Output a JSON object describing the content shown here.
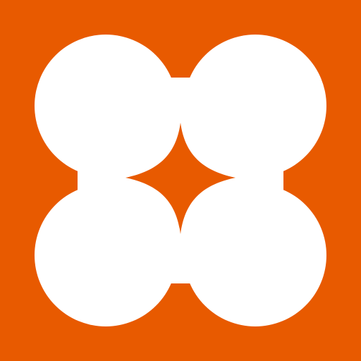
{
  "icon": {
    "name": "four-lobed-flower-sparkle",
    "colors": {
      "background": "#E85A00",
      "shape": "#FFFFFF",
      "sparkle": "#E85A00"
    }
  }
}
